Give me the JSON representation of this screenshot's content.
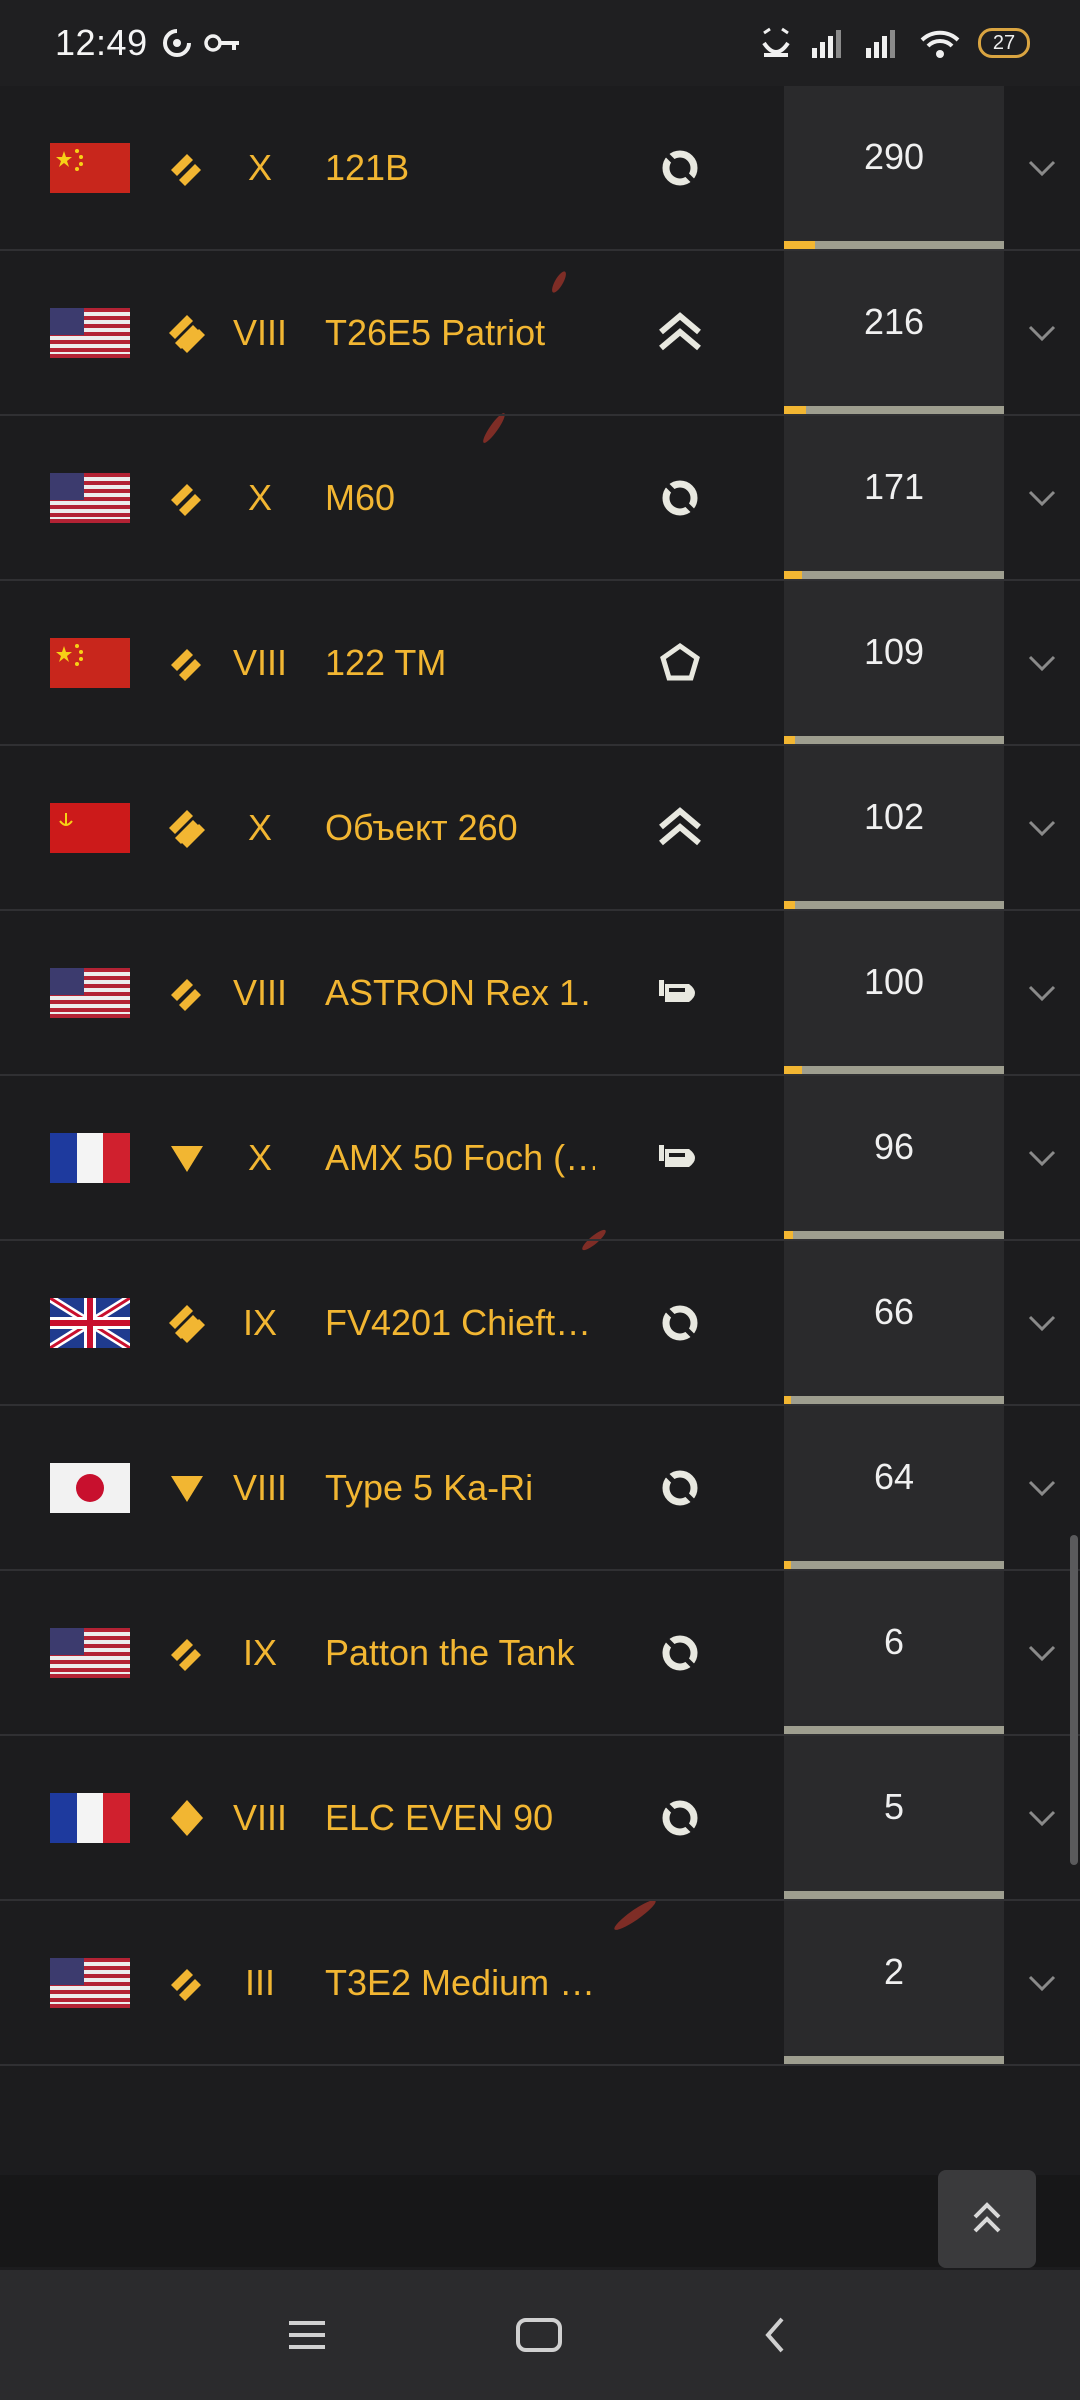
{
  "status_bar": {
    "time": "12:49",
    "battery": "27"
  },
  "vehicles": [
    {
      "nation": "china",
      "class": "medium",
      "tier": "X",
      "name": "121B",
      "type": "wheel",
      "value": "290",
      "progress": 0.14
    },
    {
      "nation": "usa",
      "class": "heavy",
      "tier": "VIII",
      "name": "T26E5 Patriot",
      "type": "chevrons",
      "value": "216",
      "progress": 0.1
    },
    {
      "nation": "usa",
      "class": "medium",
      "tier": "X",
      "name": "M60",
      "type": "wheel",
      "value": "171",
      "progress": 0.08
    },
    {
      "nation": "china",
      "class": "medium",
      "tier": "VIII",
      "name": "122 TM",
      "type": "pentagon",
      "value": "109",
      "progress": 0.05
    },
    {
      "nation": "ussr",
      "class": "heavy",
      "tier": "X",
      "name": "Объект 260",
      "type": "chevrons",
      "value": "102",
      "progress": 0.05
    },
    {
      "nation": "usa",
      "class": "medium",
      "tier": "VIII",
      "name": "ASTRON Rex 1…",
      "type": "shell",
      "value": "100",
      "progress": 0.08
    },
    {
      "nation": "france",
      "class": "td",
      "tier": "X",
      "name": "AMX 50 Foch (…",
      "type": "shell",
      "value": "96",
      "progress": 0.04
    },
    {
      "nation": "uk",
      "class": "heavy",
      "tier": "IX",
      "name": "FV4201 Chieft…",
      "type": "wheel",
      "value": "66",
      "progress": 0.03
    },
    {
      "nation": "japan",
      "class": "td",
      "tier": "VIII",
      "name": "Type 5 Ka-Ri",
      "type": "wheel",
      "value": "64",
      "progress": 0.03
    },
    {
      "nation": "usa",
      "class": "medium",
      "tier": "IX",
      "name": "Patton the Tank",
      "type": "wheel",
      "value": "6",
      "progress": 0.0
    },
    {
      "nation": "france",
      "class": "light",
      "tier": "VIII",
      "name": "ELC EVEN 90",
      "type": "wheel",
      "value": "5",
      "progress": 0.0
    },
    {
      "nation": "usa",
      "class": "medium",
      "tier": "III",
      "name": "T3E2 Medium …",
      "type": "none",
      "value": "2",
      "progress": 0.0
    }
  ],
  "colors": {
    "accent": "#f2b632",
    "row_bg": "#1c1c1e",
    "value_bg": "#2a2a2c",
    "progress_track": "#9e9e8f"
  }
}
